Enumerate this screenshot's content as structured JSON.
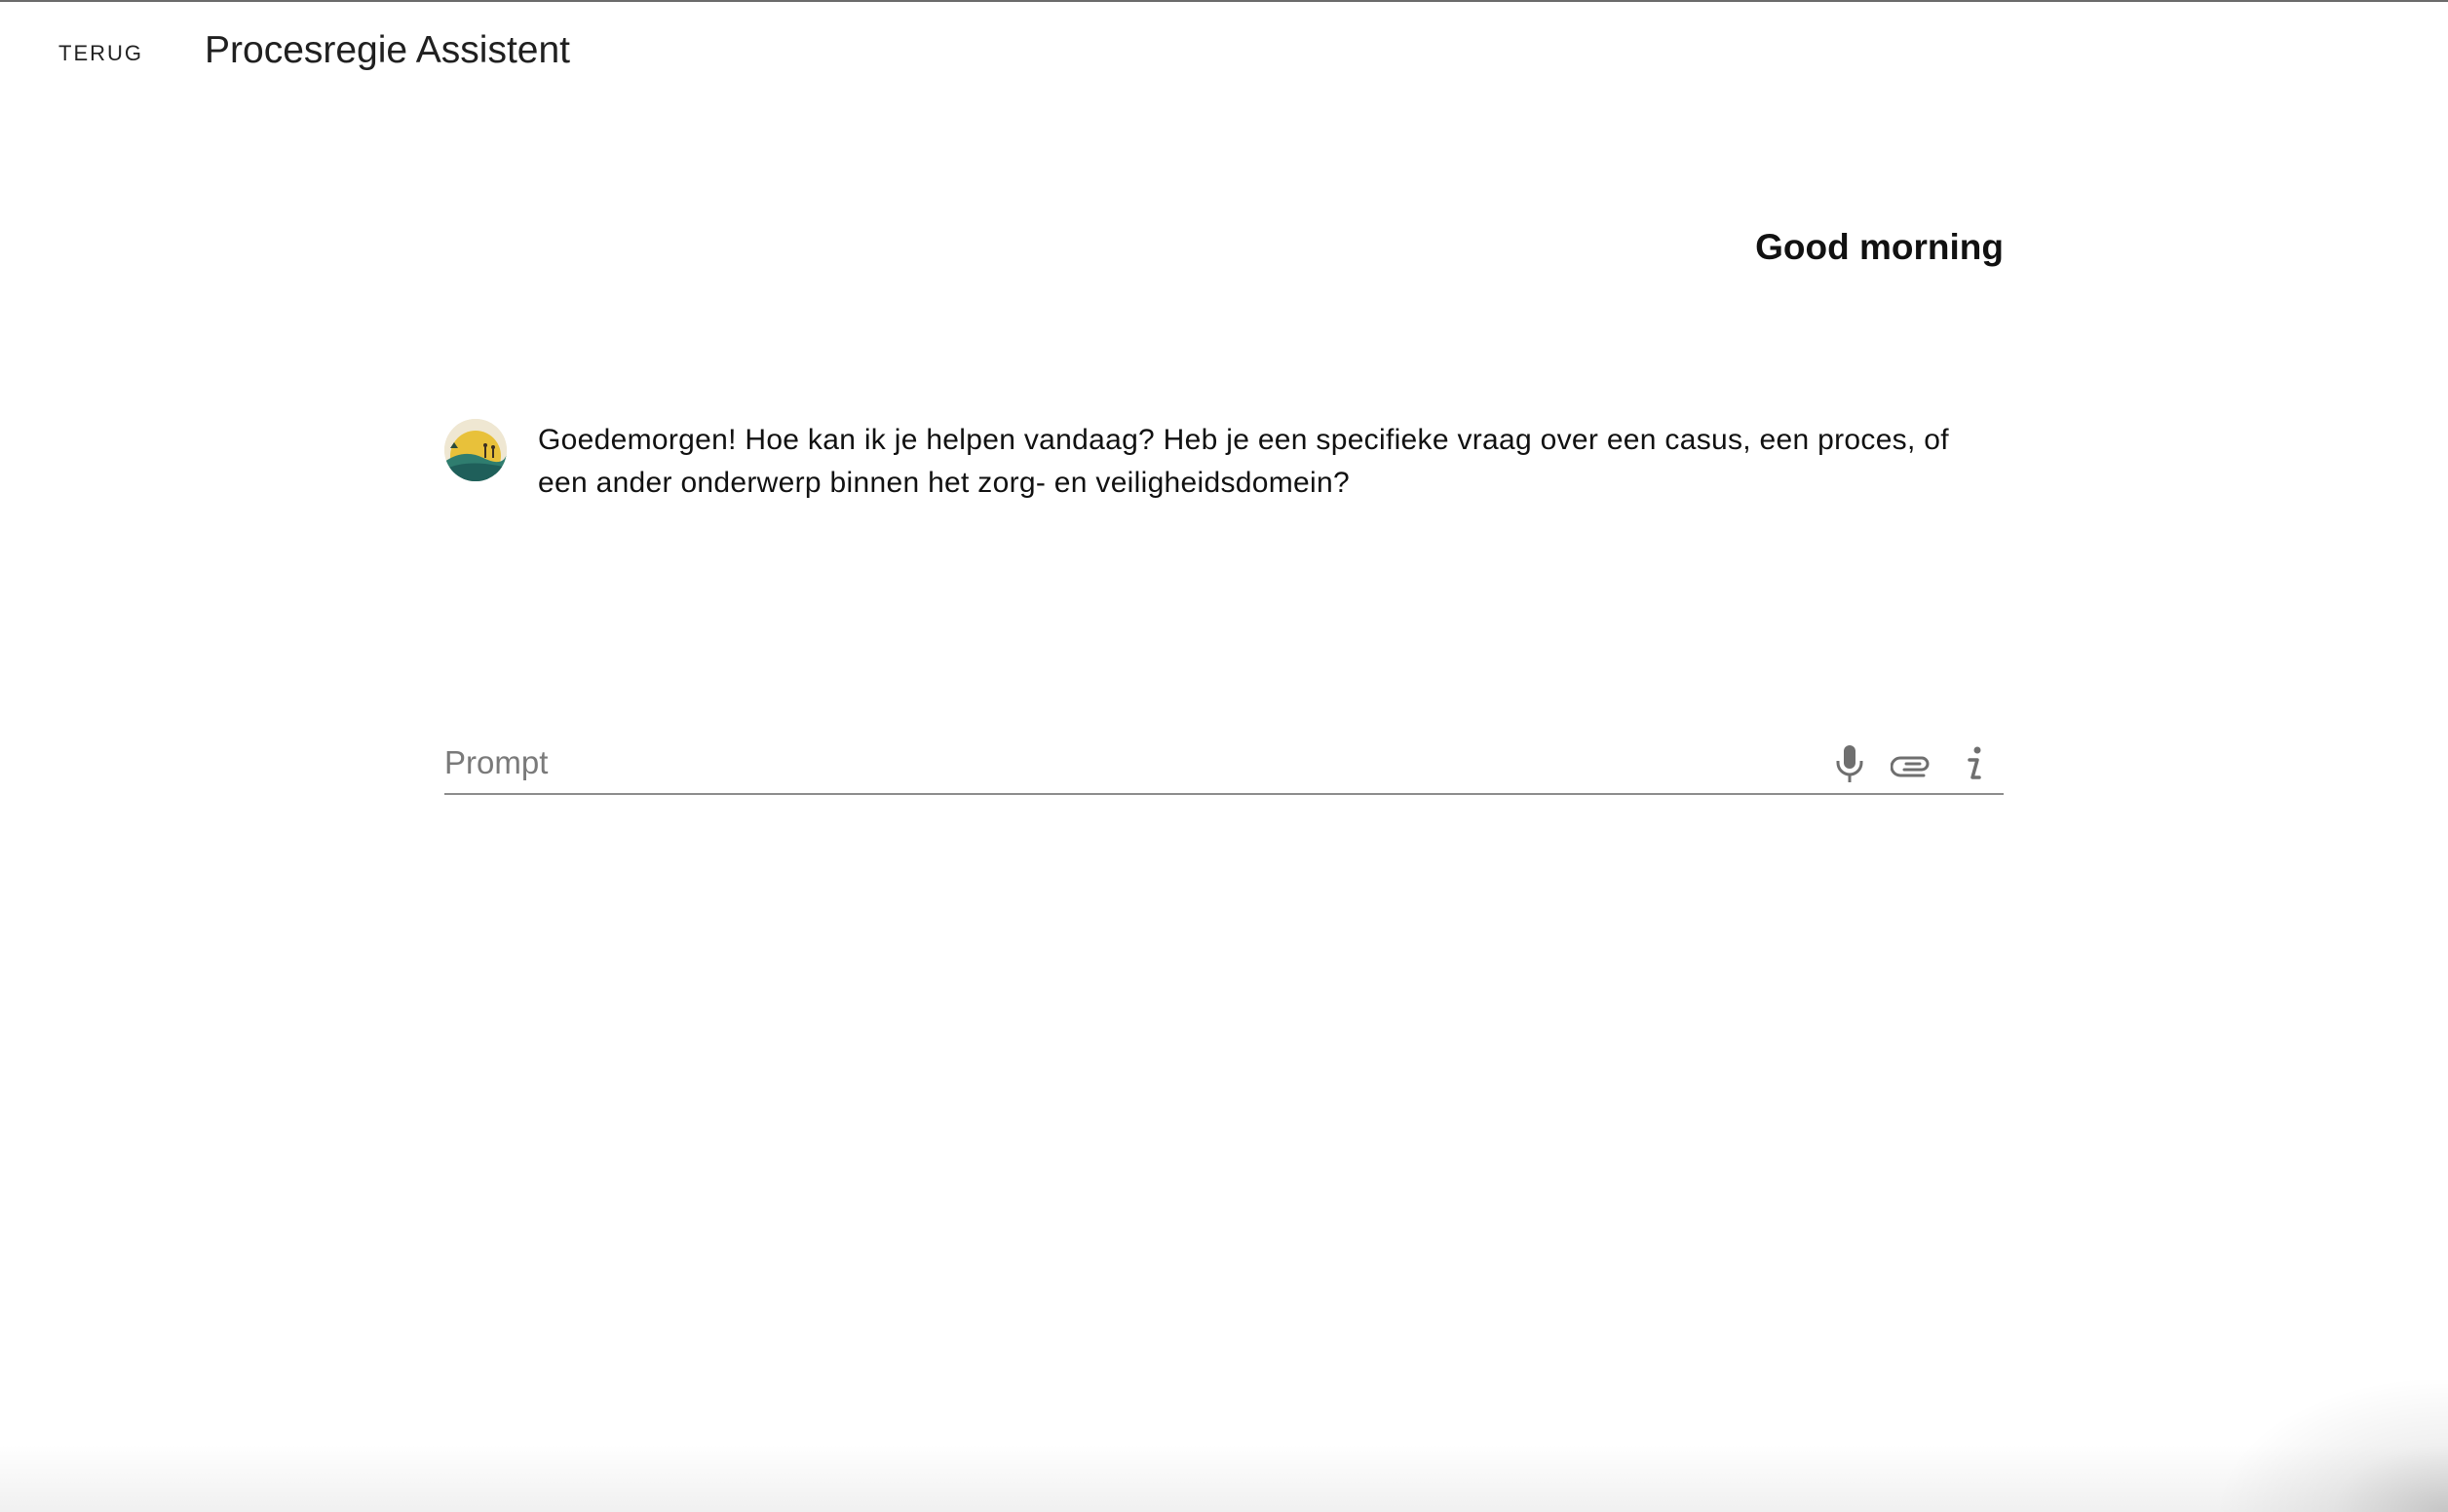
{
  "header": {
    "back_label": "TERUG",
    "title": "Procesregie Assistent"
  },
  "main": {
    "greeting": "Good morning",
    "messages": [
      {
        "sender": "assistant",
        "avatar": "assistant-avatar",
        "text": "Goedemorgen! Hoe kan ik je helpen vandaag? Heb je een specifieke vraag over een casus, een proces, of een ander onderwerp binnen het zorg- en veiligheidsdomein?"
      }
    ],
    "prompt": {
      "placeholder": "Prompt",
      "value": "",
      "icons": [
        "microphone-icon",
        "paperclip-icon",
        "info-icon"
      ]
    }
  },
  "colors": {
    "icon": "#6f6f6f",
    "underline": "#8c8c8c",
    "avatar_sun": "#e8c13a",
    "avatar_hill": "#1f5f5a"
  }
}
